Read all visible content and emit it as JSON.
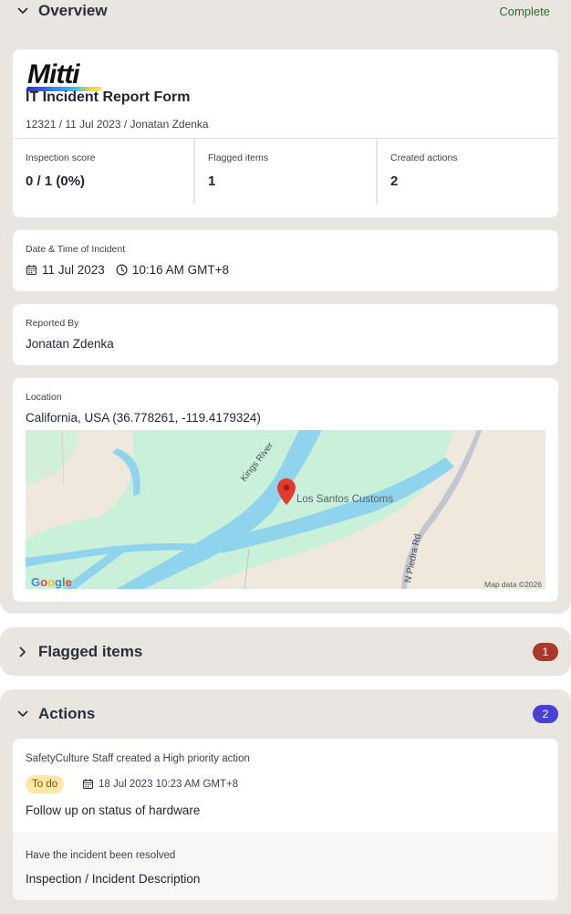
{
  "overview": {
    "title": "Overview",
    "status": "Complete",
    "logo_text": "Mitti",
    "form_title": "IT Incident Report Form",
    "meta": "12321 / 11 Jul 2023 / Jonatan Zdenka",
    "stats": [
      {
        "label": "Inspection score",
        "value": "0 / 1 (0%)"
      },
      {
        "label": "Flagged items",
        "value": "1"
      },
      {
        "label": "Created actions",
        "value": "2"
      }
    ],
    "datetime": {
      "label": "Date & Time of Incident",
      "date": "11 Jul 2023",
      "time": "10:16 AM GMT+8"
    },
    "reported": {
      "label": "Reported By",
      "value": "Jonatan Zdenka"
    },
    "location": {
      "label": "Location",
      "value": "California, USA (36.778261, -119.4179324)",
      "map": {
        "place": "Los Santos Customs",
        "river": "Kings River",
        "road": "N Piedra Rd",
        "brand": "Google",
        "attribution": "Map data ©2026"
      }
    }
  },
  "flagged": {
    "title": "Flagged items",
    "count": "1"
  },
  "actions": {
    "title": "Actions",
    "count": "2",
    "item": {
      "created_by": "SafetyCulture Staff created a High priority action",
      "status": "To do",
      "due": "18 Jul 2023 10:23 AM GMT+8",
      "title": "Follow up on status of hardware",
      "question": "Have the incident been resolved",
      "answer": "Inspection / Incident Description"
    }
  },
  "colors": {
    "section_bg": "#e9e6e1",
    "complete": "#2f6b2f",
    "flag_badge": "#a83a2a",
    "action_badge": "#4a40d4",
    "todo_bg": "#fde7a9",
    "map_green": "#c9f0d8",
    "map_water": "#8fd3ec",
    "pin": "#e33b30"
  },
  "icons": {
    "chevron_expanded": "chevron-down-icon",
    "chevron_collapsed": "chevron-right-icon",
    "date": "calendar-icon",
    "time": "clock-icon",
    "pin": "map-pin-icon"
  }
}
